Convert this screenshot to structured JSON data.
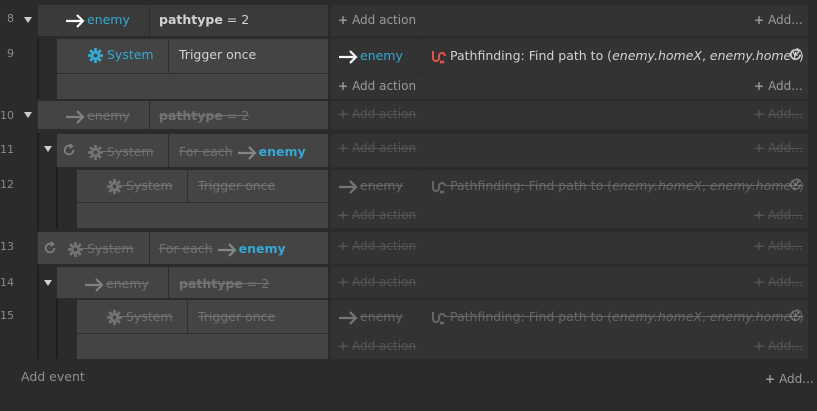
{
  "labels": {
    "add_action": "Add action",
    "add_short": "Add...",
    "add_event": "Add event",
    "add_bottom": "Add..."
  },
  "rows": [
    {
      "line": "8",
      "kind": "condition",
      "object": "enemy",
      "param": "pathtype",
      "op": "= 2",
      "disabled": false
    },
    {
      "line": "9",
      "kind": "sub",
      "system": "System",
      "condition": "Trigger once",
      "action_object": "enemy",
      "action_prefix": "Pathfinding: Find path to (",
      "arg1": "enemy.homeX",
      "comma": ", ",
      "arg2": "enemy.homeY",
      "action_suffix": ")",
      "disabled": false
    },
    {
      "line": "10",
      "kind": "condition",
      "object": "enemy",
      "param": "pathtype",
      "op": "= 2",
      "disabled": true
    },
    {
      "line": "11",
      "kind": "foreach",
      "system": "System",
      "condition": "For each",
      "object": "enemy",
      "disabled": true
    },
    {
      "line": "12",
      "kind": "sub",
      "system": "System",
      "condition": "Trigger once",
      "action_object": "enemy",
      "action_prefix": "Pathfinding: Find path to (",
      "arg1": "enemy.homeX",
      "comma": ", ",
      "arg2": "enemy.homeY",
      "action_suffix": ")",
      "disabled": true
    },
    {
      "line": "13",
      "kind": "foreach",
      "system": "System",
      "condition": "For each",
      "object": "enemy",
      "disabled": true
    },
    {
      "line": "14",
      "kind": "condition",
      "object": "enemy",
      "param": "pathtype",
      "op": "= 2",
      "disabled": true
    },
    {
      "line": "15",
      "kind": "sub",
      "system": "System",
      "condition": "Trigger once",
      "action_object": "enemy",
      "action_prefix": "Pathfinding: Find path to (",
      "arg1": "enemy.homeX",
      "comma": ", ",
      "arg2": "enemy.homeY",
      "action_suffix": ")",
      "disabled": true
    }
  ],
  "colors": {
    "object_blue": "#35a9d3",
    "pathfinding_red": "#e0524b"
  },
  "icons": {
    "arrow": "right-arrow-icon",
    "gear": "gear-icon",
    "loop": "loop-icon",
    "pathfinding": "pathfinding-icon",
    "refresh": "refresh-icon",
    "collapse": "collapse-triangle-icon"
  }
}
